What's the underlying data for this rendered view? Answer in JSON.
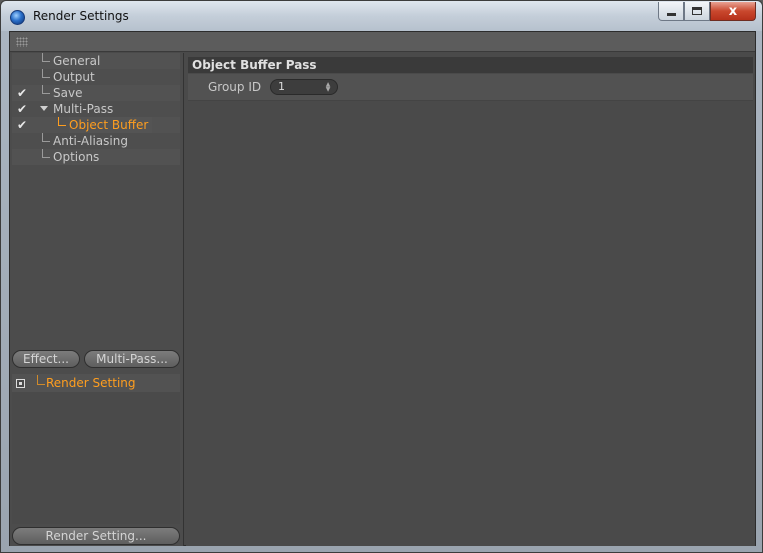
{
  "window": {
    "title": "Render Settings",
    "close_glyph": "x"
  },
  "tree": [
    {
      "label": "General",
      "checked": false
    },
    {
      "label": "Output",
      "checked": false
    },
    {
      "label": "Save",
      "checked": true
    },
    {
      "label": "Multi-Pass",
      "checked": true,
      "expanded": true
    },
    {
      "label": "Object Buffer",
      "checked": true,
      "selected": true
    },
    {
      "label": "Anti-Aliasing",
      "checked": false
    },
    {
      "label": "Options",
      "checked": false
    }
  ],
  "check_glyph": "✔",
  "buttons": {
    "effect": "Effect...",
    "multi_pass": "Multi-Pass...",
    "render_setting": "Render Setting..."
  },
  "settings_list": {
    "item": "Render Setting"
  },
  "panel": {
    "header": "Object Buffer Pass",
    "group_id_label": "Group ID",
    "group_id_value": "1"
  },
  "colors": {
    "accent_orange": "#ff9e1f",
    "panel_bg": "#4a4a4a",
    "close_red": "#c9482e"
  }
}
